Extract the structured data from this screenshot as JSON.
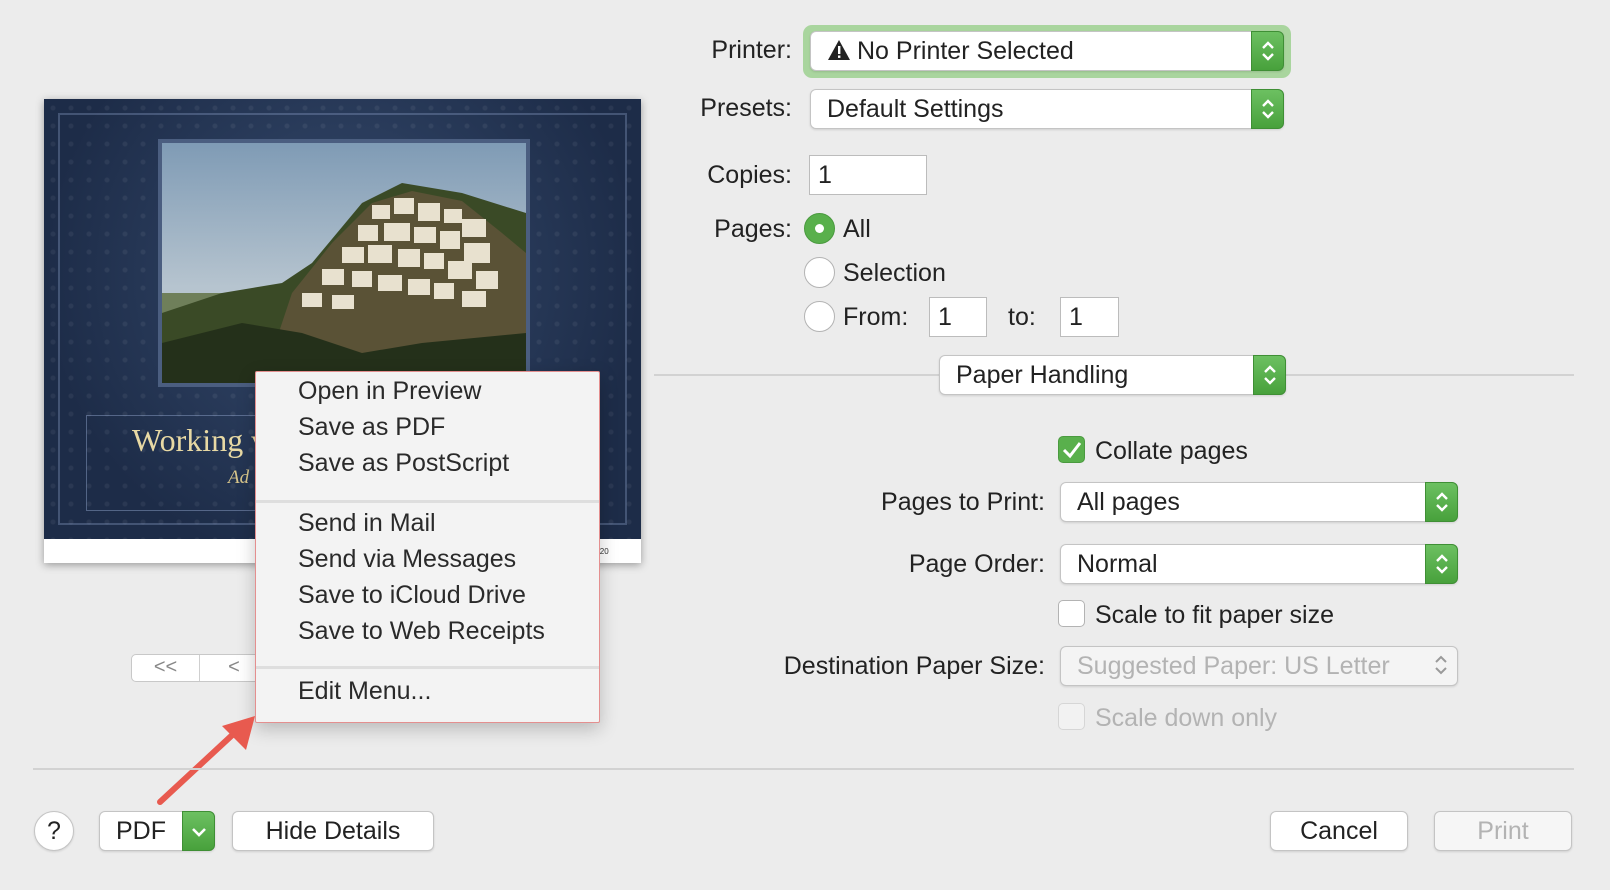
{
  "printer": {
    "label": "Printer:",
    "value": "No Printer Selected"
  },
  "presets": {
    "label": "Presets:",
    "value": "Default Settings"
  },
  "copies": {
    "label": "Copies:",
    "value": "1"
  },
  "pages": {
    "label": "Pages:",
    "all": "All",
    "selection": "Selection",
    "from_label": "From:",
    "from_value": "1",
    "to_label": "to:",
    "to_value": "1"
  },
  "section": {
    "value": "Paper Handling"
  },
  "collate": {
    "label": "Collate pages",
    "checked": true
  },
  "pages_to_print": {
    "label": "Pages to Print:",
    "value": "All pages"
  },
  "page_order": {
    "label": "Page Order:",
    "value": "Normal"
  },
  "scale_fit": {
    "label": "Scale to fit paper size",
    "checked": false
  },
  "dest_paper": {
    "label": "Destination Paper Size:",
    "value": "Suggested Paper: US Letter"
  },
  "scale_down": {
    "label": "Scale down only",
    "checked": false
  },
  "preview": {
    "title": "Working v",
    "subtitle": "Ad",
    "date": "3, 2020"
  },
  "pdf_menu": {
    "group1": [
      "Open in Preview",
      "Save as PDF",
      "Save as PostScript"
    ],
    "group2": [
      "Send in Mail",
      "Send via Messages",
      "Save to iCloud Drive",
      "Save to Web Receipts"
    ],
    "group3": [
      "Edit Menu..."
    ]
  },
  "nav": {
    "first": "<<",
    "prev": "<"
  },
  "footer": {
    "help": "?",
    "pdf": "PDF",
    "hide_details": "Hide Details",
    "cancel": "Cancel",
    "print": "Print"
  },
  "colors": {
    "accent": "#59b04c",
    "annotation_arrow": "#e85a4f"
  }
}
